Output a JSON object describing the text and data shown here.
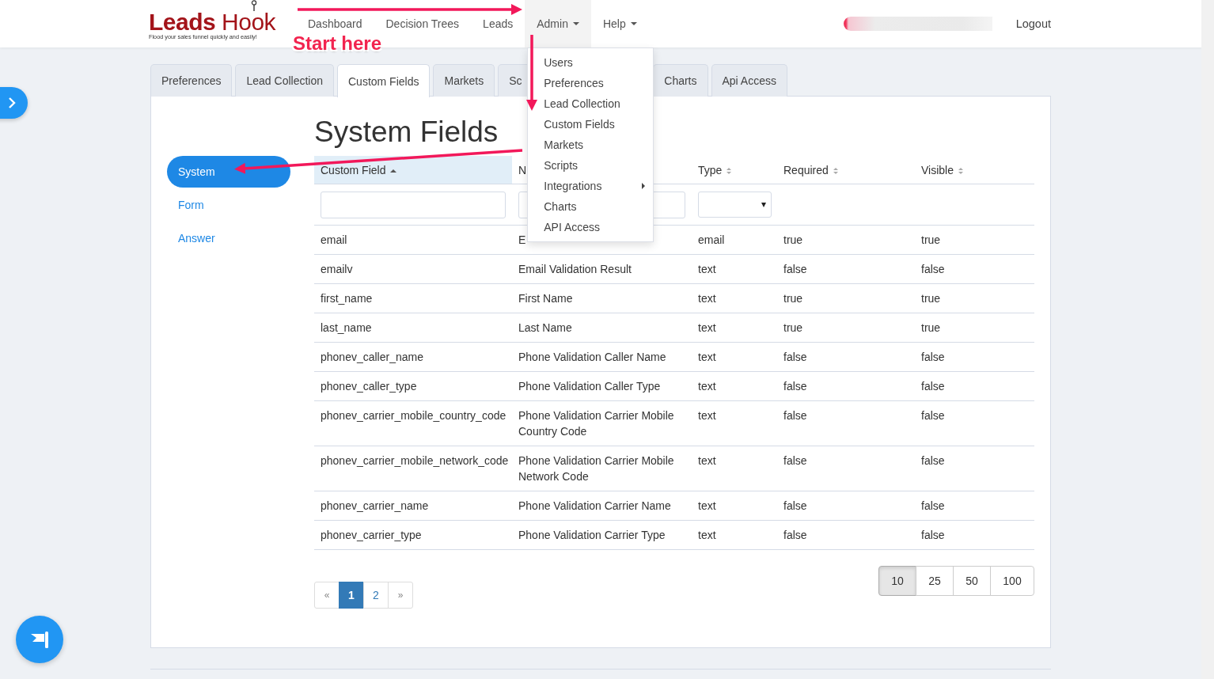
{
  "nav": {
    "logo": {
      "title": "**Leads** Hook",
      "tagline": "Flood your sales funnel quickly and easily!"
    },
    "items": [
      {
        "label": "Dashboard",
        "dropdown": false,
        "open": false
      },
      {
        "label": "Decision Trees",
        "dropdown": false,
        "open": false
      },
      {
        "label": "Leads",
        "dropdown": false,
        "open": false
      },
      {
        "label": "Admin",
        "dropdown": true,
        "open": true
      },
      {
        "label": "Help",
        "dropdown": true,
        "open": false
      }
    ],
    "logout": "Logout"
  },
  "admin_menu": [
    {
      "label": "Users",
      "submenu": false
    },
    {
      "label": "Preferences",
      "submenu": false
    },
    {
      "label": "Lead Collection",
      "submenu": false
    },
    {
      "label": "Custom Fields",
      "submenu": false
    },
    {
      "label": "Markets",
      "submenu": false
    },
    {
      "label": "Scripts",
      "submenu": false
    },
    {
      "label": "Integrations",
      "submenu": true
    },
    {
      "label": "Charts",
      "submenu": false
    },
    {
      "label": "API Access",
      "submenu": false
    }
  ],
  "tabs": [
    {
      "label": "Preferences",
      "selected": false,
      "covered": false
    },
    {
      "label": "Lead Collection",
      "selected": false,
      "covered": false
    },
    {
      "label": "Custom Fields",
      "selected": true,
      "covered": false
    },
    {
      "label": "Markets",
      "selected": false,
      "covered": false
    },
    {
      "label": "Sc",
      "selected": false,
      "covered": true
    },
    {
      "label": "Charts",
      "selected": false,
      "covered": false
    },
    {
      "label": "Api Access",
      "selected": false,
      "covered": false
    }
  ],
  "side_menu": [
    {
      "label": "System",
      "selected": true
    },
    {
      "label": "Form",
      "selected": false
    },
    {
      "label": "Answer",
      "selected": false
    }
  ],
  "heading": "System Fields",
  "table": {
    "columns": [
      {
        "label": "Custom Field",
        "sorted": true,
        "sortable": true
      },
      {
        "label": "N",
        "sorted": false,
        "sortable": false
      },
      {
        "label": "Type",
        "sorted": false,
        "sortable": true
      },
      {
        "label": "Required",
        "sorted": false,
        "sortable": true
      },
      {
        "label": "Visible",
        "sorted": false,
        "sortable": true
      }
    ],
    "filters": [
      {
        "kind": "text"
      },
      {
        "kind": "text"
      },
      {
        "kind": "select"
      }
    ],
    "rows": [
      [
        "email",
        "E",
        "email",
        "true",
        "true"
      ],
      [
        "emailv",
        "Email Validation Result",
        "text",
        "false",
        "false"
      ],
      [
        "first_name",
        "First Name",
        "text",
        "true",
        "true"
      ],
      [
        "last_name",
        "Last Name",
        "text",
        "true",
        "true"
      ],
      [
        "phonev_caller_name",
        "Phone Validation Caller Name",
        "text",
        "false",
        "false"
      ],
      [
        "phonev_caller_type",
        "Phone Validation Caller Type",
        "text",
        "false",
        "false"
      ],
      [
        "phonev_carrier_mobile_country_code",
        "Phone Validation Carrier Mobile Country Code",
        "text",
        "false",
        "false"
      ],
      [
        "phonev_carrier_mobile_network_code",
        "Phone Validation Carrier Mobile Network Code",
        "text",
        "false",
        "false"
      ],
      [
        "phonev_carrier_name",
        "Phone Validation Carrier Name",
        "text",
        "false",
        "false"
      ],
      [
        "phonev_carrier_type",
        "Phone Validation Carrier Type",
        "text",
        "false",
        "false"
      ]
    ]
  },
  "pagination": [
    {
      "label": "«",
      "kind": "prev",
      "selected": false
    },
    {
      "label": "1",
      "kind": "page",
      "selected": true
    },
    {
      "label": "2",
      "kind": "page",
      "selected": false
    },
    {
      "label": "»",
      "kind": "next",
      "selected": false
    }
  ],
  "page_sizes": [
    {
      "label": "10",
      "selected": true
    },
    {
      "label": "25",
      "selected": false
    },
    {
      "label": "50",
      "selected": false
    },
    {
      "label": "100",
      "selected": false
    }
  ],
  "annotation": {
    "label": "Start here"
  }
}
